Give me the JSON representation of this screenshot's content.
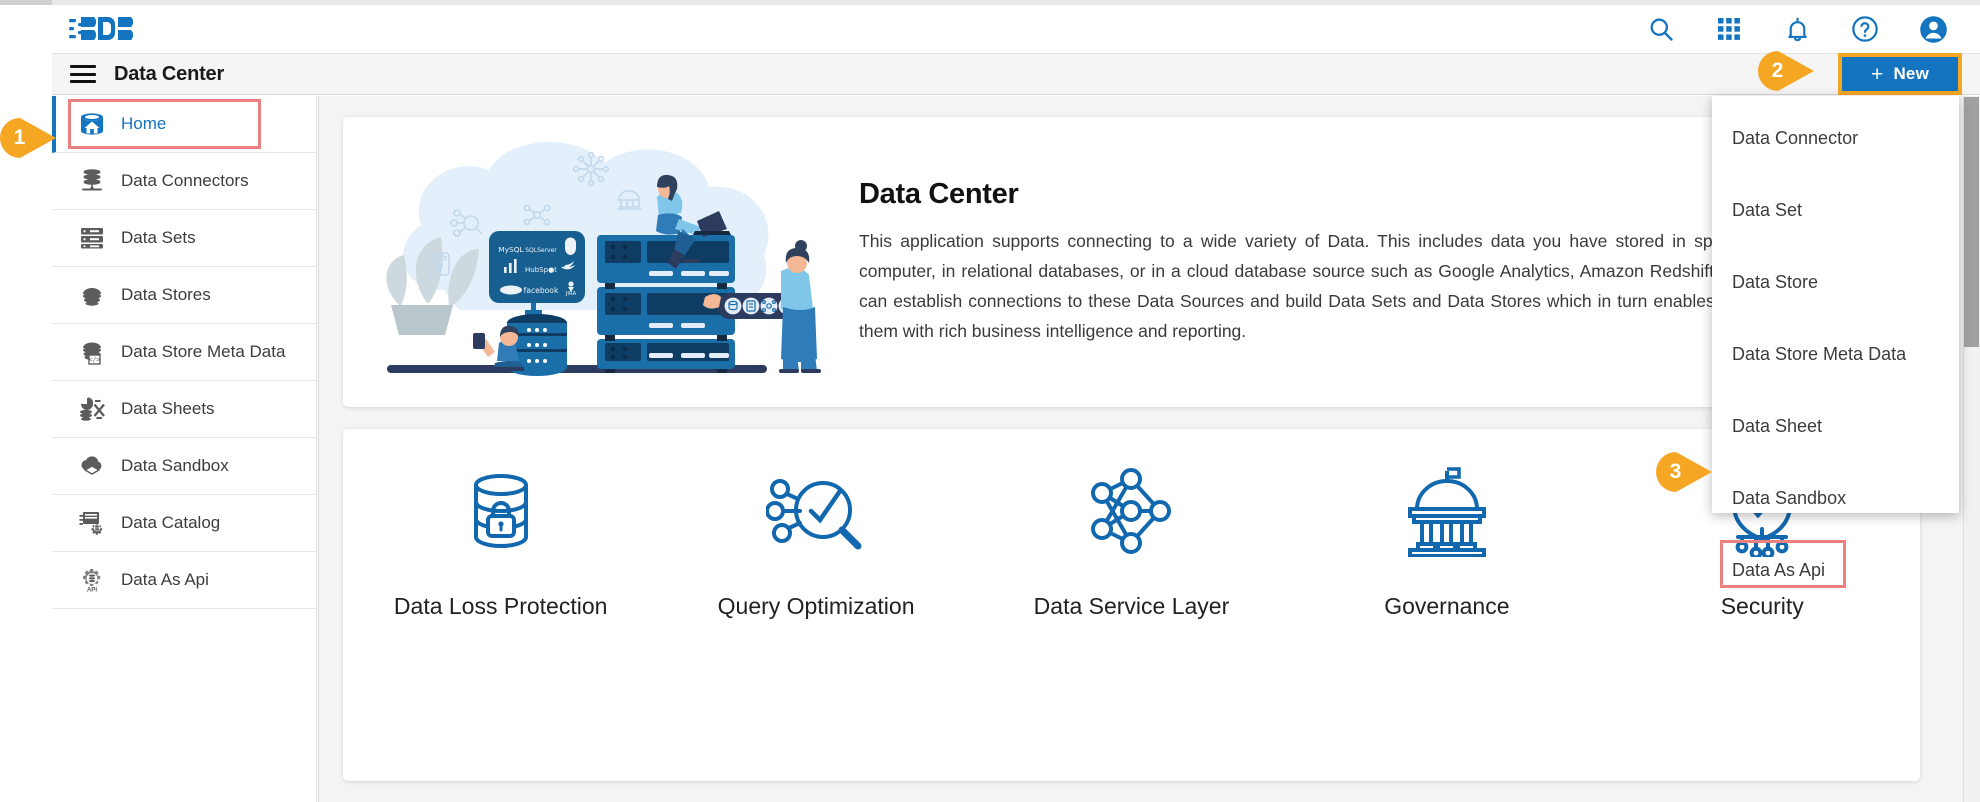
{
  "app": {
    "logo_text": "BDB",
    "brand_blue": "#1474bf",
    "accent_orange": "#F5A623",
    "highlight_red": "#e8817f"
  },
  "appbar": {
    "icons": [
      {
        "name": "search-icon",
        "label": "Search"
      },
      {
        "name": "apps-grid-icon",
        "label": "Apps"
      },
      {
        "name": "notifications-bell-icon",
        "label": "Notifications"
      },
      {
        "name": "help-circle-icon",
        "label": "Help"
      },
      {
        "name": "user-account-icon",
        "label": "Account"
      }
    ]
  },
  "subheader": {
    "menu_icon": "hamburger-menu-icon",
    "title": "Data Center",
    "new_button": {
      "plus": "+",
      "label": "New"
    }
  },
  "sidebar": {
    "items": [
      {
        "label": "Home",
        "icon": "database-home-icon",
        "active": true
      },
      {
        "label": "Data Connectors",
        "icon": "database-stack-icon",
        "active": false
      },
      {
        "label": "Data Sets",
        "icon": "server-rack-icon",
        "active": false
      },
      {
        "label": "Data Stores",
        "icon": "data-store-icon",
        "active": false
      },
      {
        "label": "Data Store Meta Data",
        "icon": "data-store-meta-icon",
        "active": false
      },
      {
        "label": "Data Sheets",
        "icon": "data-sheets-icon",
        "active": false
      },
      {
        "label": "Data Sandbox",
        "icon": "cloud-sandbox-icon",
        "active": false
      },
      {
        "label": "Data Catalog",
        "icon": "data-catalog-gear-icon",
        "active": false
      },
      {
        "label": "Data As Api",
        "icon": "data-as-api-gear-icon",
        "active": false
      }
    ]
  },
  "hero": {
    "illustration": "data-center-illustration",
    "title": "Data Center",
    "paragraph": "This application supports connecting to a wide variety of Data. This includes data you have stored in spreadsheets on your computer, in relational databases, or in a cloud database source such as Google Analytics, Amazon Redshift, or Salesforce. You can establish connections to these Data Sources and build Data Sets and Data Stores which in turn enables the user to provide them with rich business intelligence and reporting."
  },
  "features": [
    {
      "label": "Data Loss Protection",
      "icon": "database-lock-icon"
    },
    {
      "label": "Query Optimization",
      "icon": "magnifier-check-nodes-icon"
    },
    {
      "label": "Data Service Layer",
      "icon": "neural-network-icon"
    },
    {
      "label": "Governance",
      "icon": "government-building-icon"
    },
    {
      "label": "Security",
      "icon": "security-shield-nodes-icon"
    }
  ],
  "dropdown": {
    "items": [
      {
        "label": "Data Connector",
        "highlighted": false
      },
      {
        "label": "Data Set",
        "highlighted": false
      },
      {
        "label": "Data Store",
        "highlighted": false
      },
      {
        "label": "Data Store Meta Data",
        "highlighted": false
      },
      {
        "label": "Data Sheet",
        "highlighted": false
      },
      {
        "label": "Data Sandbox",
        "highlighted": false
      },
      {
        "label": "Data As Api",
        "highlighted": true
      }
    ]
  },
  "annotations": [
    {
      "number": "1",
      "target": "sidebar-item-home"
    },
    {
      "number": "2",
      "target": "new-button"
    },
    {
      "number": "3",
      "target": "dropdown-item-data-as-api"
    }
  ]
}
